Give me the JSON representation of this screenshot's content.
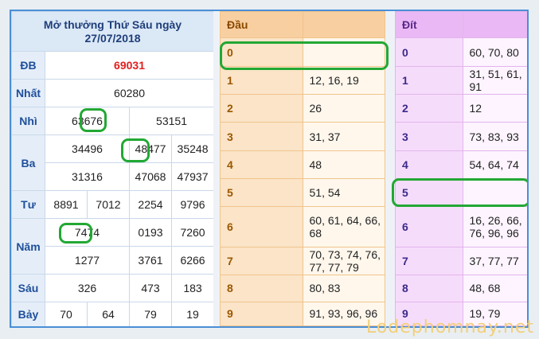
{
  "header": {
    "title_line1": "Mở thưởng Thứ Sáu ngày",
    "title_line2": "27/07/2018"
  },
  "results": {
    "db": {
      "label": "ĐB",
      "value": "69031"
    },
    "nhat": {
      "label": "Nhất",
      "value": "60280"
    },
    "nhi": {
      "label": "Nhì",
      "values": [
        "63676",
        "53151"
      ]
    },
    "ba": {
      "label": "Ba",
      "row1": [
        "34496",
        "48477",
        "35248"
      ],
      "row2": [
        "31316",
        "47068",
        "47937"
      ]
    },
    "tu": {
      "label": "Tư",
      "values": [
        "8891",
        "7012",
        "2254",
        "9796"
      ]
    },
    "nam": {
      "label": "Năm",
      "row1": [
        "7474",
        "0193",
        "7260"
      ],
      "row2": [
        "1277",
        "3761",
        "6266"
      ]
    },
    "sau": {
      "label": "Sáu",
      "values": [
        "326",
        "473",
        "183"
      ]
    },
    "bay": {
      "label": "Bảy",
      "values": [
        "70",
        "64",
        "79",
        "19"
      ]
    }
  },
  "dau": {
    "header": "Đầu",
    "rows": [
      {
        "key": "0",
        "value": ""
      },
      {
        "key": "1",
        "value": "12, 16, 19"
      },
      {
        "key": "2",
        "value": "26"
      },
      {
        "key": "3",
        "value": "31, 37"
      },
      {
        "key": "4",
        "value": "48"
      },
      {
        "key": "5",
        "value": "51, 54"
      },
      {
        "key": "6",
        "value": "60, 61, 64, 66, 68"
      },
      {
        "key": "7",
        "value": "70, 73, 74, 76, 77, 77, 79"
      },
      {
        "key": "8",
        "value": "80, 83"
      },
      {
        "key": "9",
        "value": "91, 93, 96, 96"
      }
    ]
  },
  "dit": {
    "header": "Đít",
    "rows": [
      {
        "key": "0",
        "value": "60, 70, 80"
      },
      {
        "key": "1",
        "value": "31, 51, 61, 91"
      },
      {
        "key": "2",
        "value": "12"
      },
      {
        "key": "3",
        "value": "73, 83, 93"
      },
      {
        "key": "4",
        "value": "54, 64, 74"
      },
      {
        "key": "5",
        "value": ""
      },
      {
        "key": "6",
        "value": "16, 26, 66, 76, 96, 96"
      },
      {
        "key": "7",
        "value": "37, 77, 77"
      },
      {
        "key": "8",
        "value": "48, 68"
      },
      {
        "key": "9",
        "value": "19, 79"
      }
    ]
  },
  "watermark": "Lodephomnay.net",
  "colors": {
    "frame": "#4a8fd6",
    "highlight": "#22a834",
    "special_prize": "#e0201e"
  }
}
